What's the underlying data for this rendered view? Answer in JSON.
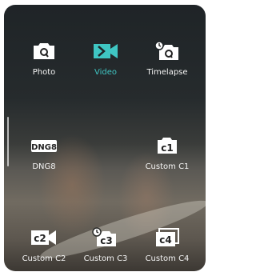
{
  "modes": {
    "photo": {
      "label": "Photo",
      "icon": "camera-icon"
    },
    "video": {
      "label": "Video",
      "icon": "video-camera-icon",
      "active": true
    },
    "timelapse": {
      "label": "Timelapse",
      "icon": "timelapse-icon"
    },
    "dng8": {
      "label": "DNG8",
      "icon": "dng8-icon",
      "badge": "DNG8"
    },
    "custom_c1": {
      "label": "Custom C1",
      "icon": "custom-c1-icon",
      "badge": "c1"
    },
    "custom_c2": {
      "label": "Custom C2",
      "icon": "custom-c2-icon",
      "badge": "c2"
    },
    "custom_c3": {
      "label": "Custom C3",
      "icon": "custom-c3-icon",
      "badge": "c3"
    },
    "custom_c4": {
      "label": "Custom C4",
      "icon": "custom-c4-icon",
      "badge": "c4"
    }
  },
  "colors": {
    "accent": "#3fc6c3",
    "text": "#f4f4f4"
  }
}
